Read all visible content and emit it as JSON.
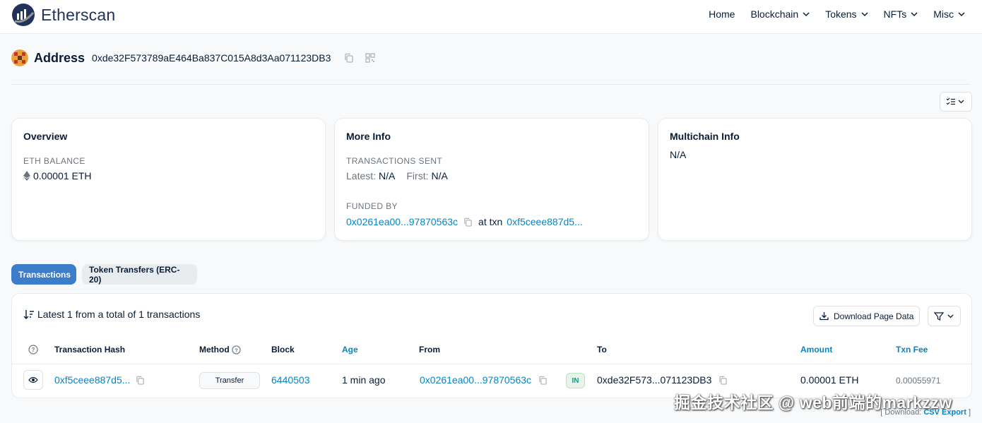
{
  "header": {
    "brand": "Etherscan",
    "nav": [
      {
        "label": "Home",
        "dropdown": false
      },
      {
        "label": "Blockchain",
        "dropdown": true
      },
      {
        "label": "Tokens",
        "dropdown": true
      },
      {
        "label": "NFTs",
        "dropdown": true
      },
      {
        "label": "Misc",
        "dropdown": true
      }
    ]
  },
  "address": {
    "title": "Address",
    "value": "0xde32F573789aE464Ba837C015A8d3Aa071123DB3",
    "icons": [
      "copy-icon",
      "qr-code-icon"
    ]
  },
  "overview": {
    "title": "Overview",
    "balance_label": "ETH BALANCE",
    "balance_value": "0.00001 ETH"
  },
  "more_info": {
    "title": "More Info",
    "sent_label": "TRANSACTIONS SENT",
    "latest_label": "Latest:",
    "latest_value": "N/A",
    "first_label": "First:",
    "first_value": "N/A",
    "funded_label": "FUNDED BY",
    "funded_address": "0x0261ea00...97870563c",
    "at_txn_label": "at txn",
    "funded_txn": "0xf5ceee887d5..."
  },
  "multichain": {
    "title": "Multichain Info",
    "value": "N/A"
  },
  "tabs": [
    {
      "label": "Transactions",
      "active": true
    },
    {
      "label": "Token Transfers (ERC-20)",
      "active": false
    }
  ],
  "table": {
    "summary": "Latest 1 from a total of 1 transactions",
    "download_label": "Download Page Data",
    "columns": {
      "hash": "Transaction Hash",
      "method": "Method",
      "block": "Block",
      "age": "Age",
      "from": "From",
      "to": "To",
      "amount": "Amount",
      "fee": "Txn Fee"
    },
    "rows": [
      {
        "hash": "0xf5ceee887d5...",
        "method": "Transfer",
        "block": "6440503",
        "age": "1 min ago",
        "from": "0x0261ea00...97870563c",
        "direction": "IN",
        "to": "0xde32F573...071123DB3",
        "amount": "0.00001 ETH",
        "fee": "0.00055971"
      }
    ]
  },
  "footer": {
    "download_prefix": "[ Download:",
    "csv_label": "CSV Export",
    "suffix": "]"
  },
  "watermark": "掘金技术社区 @ web前端的markzzw",
  "colors": {
    "accent": "#3d7cc9",
    "link": "#0784c3",
    "brand": "#21325b",
    "in_badge": "#00a186"
  }
}
